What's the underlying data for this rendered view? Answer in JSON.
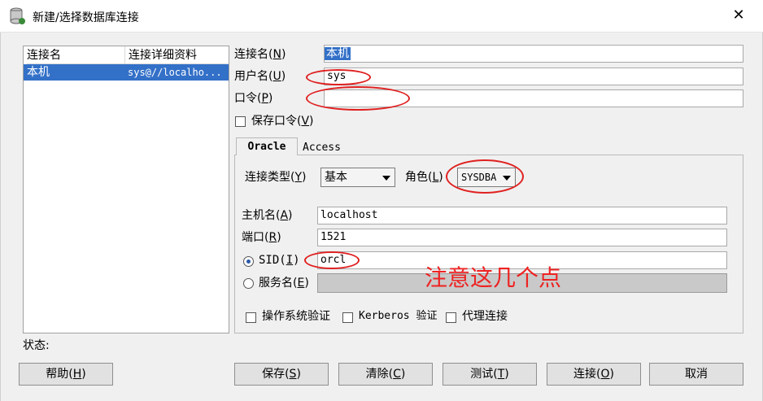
{
  "window": {
    "title": "新建/选择数据库连接",
    "close_glyph": "✕"
  },
  "list": {
    "headers": [
      "连接名",
      "连接详细资料"
    ],
    "rows": [
      {
        "name": "本机",
        "detail": "sys@//localho..."
      }
    ]
  },
  "form": {
    "conn_name_label": "连接名(",
    "conn_name_key": "N",
    "conn_name_value": "本机",
    "user_label": "用户名(",
    "user_key": "U",
    "user_value": "sys",
    "pwd_label": "口令(",
    "pwd_key": "P",
    "pwd_value": "",
    "save_pwd_label": "保存口令(",
    "save_pwd_key": "V"
  },
  "tabs": {
    "oracle": "Oracle",
    "access": "Access"
  },
  "oracle": {
    "conn_type_label": "连接类型(",
    "conn_type_key": "Y",
    "conn_type_value": "基本",
    "role_label": "角色(",
    "role_key": "L",
    "role_value": "SYSDBA",
    "host_label": "主机名(",
    "host_key": "A",
    "host_value": "localhost",
    "port_label": "端口(",
    "port_key": "R",
    "port_value": "1521",
    "sid_label": "SID(",
    "sid_key": "I",
    "sid_value": "orcl",
    "service_label": "服务名(",
    "service_key": "E",
    "os_auth_label": "操作系统验证",
    "kerberos_label": "Kerberos 验证",
    "proxy_label": "代理连接"
  },
  "status_label": "状态:",
  "buttons": {
    "help": "帮助(",
    "help_key": "H",
    "save": "保存(",
    "save_key": "S",
    "clear": "清除(",
    "clear_key": "C",
    "test": "测试(",
    "test_key": "T",
    "connect": "连接(",
    "connect_key": "O",
    "cancel": "取消"
  },
  "annotation": {
    "note": "注意这几个点",
    "color": "#ee2222"
  }
}
